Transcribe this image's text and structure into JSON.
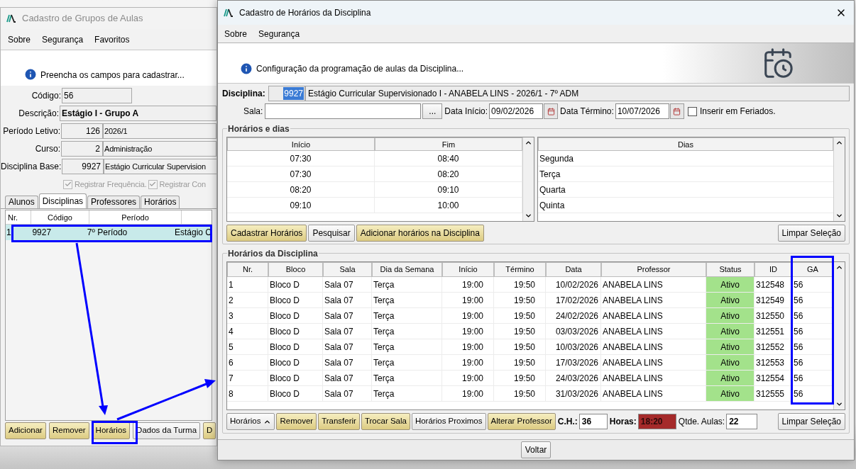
{
  "back_window": {
    "title": "Cadastro de Grupos de Aulas",
    "menu": [
      "Sobre",
      "Segurança",
      "Favoritos"
    ],
    "info": "Preencha os campos para cadastrar...",
    "fields": [
      {
        "label": "Código:",
        "value": "56",
        "kind": "short"
      },
      {
        "label": "Descrição:",
        "value": "Estágio I - Grupo A",
        "kind": "bold"
      },
      {
        "label": "Período Letivo:",
        "code": "126",
        "value": "2026/1",
        "kind": "coded"
      },
      {
        "label": "Curso:",
        "code": "2",
        "value": "Administração",
        "kind": "coded"
      },
      {
        "label": "Disciplina Base:",
        "code": "9927",
        "value": "Estágio Curricular Supervision",
        "kind": "coded"
      }
    ],
    "checkboxes": [
      {
        "label": "Registrar Frequência.",
        "checked": true,
        "disabled": true
      },
      {
        "label": "Registrar Con",
        "checked": true,
        "disabled": true
      }
    ],
    "tabs": [
      {
        "label": "Alunos",
        "selected": false
      },
      {
        "label": "Disciplinas",
        "selected": true
      },
      {
        "label": "Professores",
        "selected": false
      },
      {
        "label": "Horários",
        "selected": false
      }
    ],
    "table": {
      "columns": [
        "Nr.",
        "Código",
        "Período"
      ],
      "rows": [
        {
          "cells": [
            "1",
            "9927",
            "7º Período",
            "Estágio C"
          ],
          "selected": true
        }
      ]
    },
    "buttons": [
      {
        "label": "Adicionar",
        "kind": "accent"
      },
      {
        "label": "Remover",
        "kind": "accent"
      },
      {
        "label": "Horários",
        "kind": "accent"
      },
      {
        "label": "Dados da Turma",
        "kind": "plain"
      },
      {
        "label": "D",
        "kind": "accent"
      }
    ]
  },
  "front_window": {
    "title": "Cadastro de Horários da Disciplina",
    "menu": [
      "Sobre",
      "Segurança"
    ],
    "info": "Configuração da programação de aulas da Disciplina...",
    "disciplina": {
      "label": "Disciplina:",
      "code": "9927",
      "code_selected": true,
      "value": "Estágio Curricular Supervisionado I - ANABELA LINS - 2026/1 - 7º ADM"
    },
    "sala": {
      "label": "Sala:",
      "button": "..."
    },
    "start_date": {
      "label": "Data Início:",
      "value": "09/02/2026"
    },
    "end_date": {
      "label": "Data Término:",
      "value": "10/07/2026"
    },
    "holidays": {
      "label": "Inserir em Feriados.",
      "checked": false
    },
    "schedule_group": {
      "title": "Horários e dias",
      "times": {
        "columns": [
          "Início",
          "Fim"
        ],
        "rows": [
          [
            "07:30",
            "08:40"
          ],
          [
            "07:30",
            "08:20"
          ],
          [
            "08:20",
            "09:10"
          ],
          [
            "09:10",
            "10:00"
          ]
        ]
      },
      "days": {
        "column": "Dias",
        "rows": [
          "Segunda",
          "Terça",
          "Quarta",
          "Quinta"
        ]
      },
      "buttons": [
        {
          "label": "Cadastrar Horários",
          "kind": "accent"
        },
        {
          "label": "Pesquisar",
          "kind": "plain"
        },
        {
          "label": "Adicionar horários na Disciplina",
          "kind": "accent"
        }
      ],
      "clear_button": "Limpar Seleção"
    },
    "lessons_group": {
      "title": "Horários da Disciplina",
      "columns": [
        "Nr.",
        "Bloco",
        "Sala",
        "Dia da Semana",
        "Início",
        "Término",
        "Data",
        "Professor",
        "Status",
        "ID",
        "GA"
      ],
      "rows": [
        {
          "cells": [
            "1",
            "Bloco D",
            "Sala 07",
            "Terça",
            "19:00",
            "19:50",
            "10/02/2026",
            "ANABELA LINS",
            "Ativo",
            "312548",
            "56"
          ],
          "active": true
        },
        {
          "cells": [
            "2",
            "Bloco D",
            "Sala 07",
            "Terça",
            "19:00",
            "19:50",
            "17/02/2026",
            "ANABELA LINS",
            "Ativo",
            "312549",
            "56"
          ],
          "active": true
        },
        {
          "cells": [
            "3",
            "Bloco D",
            "Sala 07",
            "Terça",
            "19:00",
            "19:50",
            "24/02/2026",
            "ANABELA LINS",
            "Ativo",
            "312550",
            "56"
          ],
          "active": true
        },
        {
          "cells": [
            "4",
            "Bloco D",
            "Sala 07",
            "Terça",
            "19:00",
            "19:50",
            "03/03/2026",
            "ANABELA LINS",
            "Ativo",
            "312551",
            "56"
          ],
          "active": true
        },
        {
          "cells": [
            "5",
            "Bloco D",
            "Sala 07",
            "Terça",
            "19:00",
            "19:50",
            "10/03/2026",
            "ANABELA LINS",
            "Ativo",
            "312552",
            "56"
          ],
          "active": true
        },
        {
          "cells": [
            "6",
            "Bloco D",
            "Sala 07",
            "Terça",
            "19:00",
            "19:50",
            "17/03/2026",
            "ANABELA LINS",
            "Ativo",
            "312553",
            "56"
          ],
          "active": true
        },
        {
          "cells": [
            "7",
            "Bloco D",
            "Sala 07",
            "Terça",
            "19:00",
            "19:50",
            "24/03/2026",
            "ANABELA LINS",
            "Ativo",
            "312554",
            "56"
          ],
          "active": true
        },
        {
          "cells": [
            "8",
            "Bloco D",
            "Sala 07",
            "Terça",
            "19:00",
            "19:50",
            "31/03/2026",
            "ANABELA LINS",
            "Ativo",
            "312555",
            "56"
          ],
          "active": true
        }
      ],
      "buttons": [
        {
          "label": "Horários",
          "kind": "menu"
        },
        {
          "label": "Remover",
          "kind": "accent"
        },
        {
          "label": "Transferir",
          "kind": "accent"
        },
        {
          "label": "Trocar Sala",
          "kind": "accent"
        },
        {
          "label": "Horários Proximos",
          "kind": "plain"
        },
        {
          "label": "Alterar Professor",
          "kind": "accent"
        }
      ],
      "totals": [
        {
          "label": "C.H.:",
          "value": "36",
          "emphasis": true,
          "alert": false
        },
        {
          "label": "Horas:",
          "value": "18:20",
          "emphasis": true,
          "alert": true
        },
        {
          "label": "Qtde. Aulas:",
          "value": "22",
          "emphasis": false,
          "alert": false
        }
      ],
      "clear_button": "Limpar Seleção"
    },
    "back_button": "Voltar"
  }
}
